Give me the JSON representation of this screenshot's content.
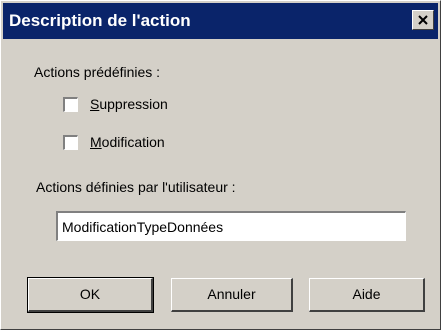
{
  "dialog": {
    "title": "Description de l'action",
    "close_glyph": "✕"
  },
  "predefined": {
    "label": "Actions prédéfinies :",
    "options": [
      {
        "mnemonic": "S",
        "rest": "uppression",
        "checked": false
      },
      {
        "mnemonic": "M",
        "rest": "odification",
        "checked": false
      }
    ]
  },
  "user_defined": {
    "label": "Actions définies par l'utilisateur :",
    "value": "ModificationTypeDonnées"
  },
  "buttons": {
    "ok": "OK",
    "cancel": "Annuler",
    "help": "Aide"
  },
  "colors": {
    "titlebar": "#0a246a",
    "face": "#d4d0c8"
  }
}
